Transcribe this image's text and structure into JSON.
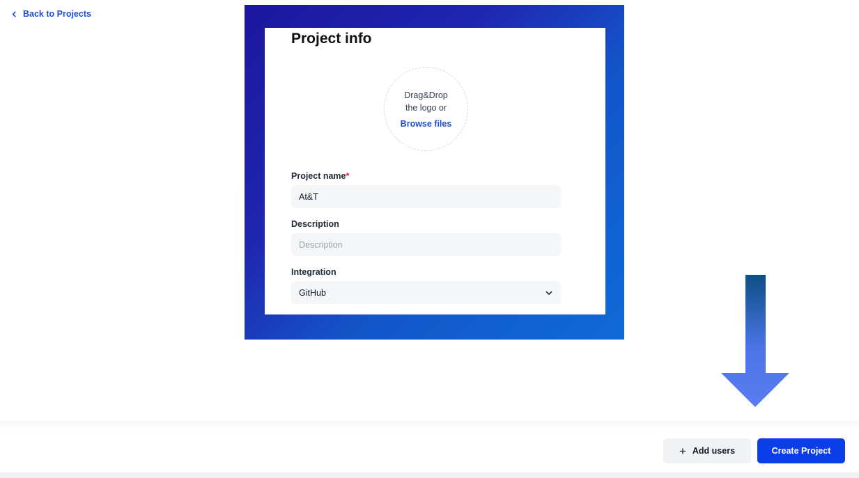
{
  "nav": {
    "back_label": "Back to Projects"
  },
  "form": {
    "title": "Project info",
    "dropzone": {
      "line1": "Drag&Drop",
      "line2": "the logo or",
      "browse_label": "Browse files"
    },
    "project_name": {
      "label": "Project name",
      "required_marker": "*",
      "value": "At&T"
    },
    "description": {
      "label": "Description",
      "placeholder": "Description",
      "value": ""
    },
    "integration": {
      "label": "Integration",
      "selected": "GitHub"
    }
  },
  "footer": {
    "add_users_label": "Add users",
    "create_label": "Create Project"
  },
  "colors": {
    "accent": "#0c3ee8",
    "link": "#1d4ed8",
    "frame_gradient_start": "#1c159e",
    "frame_gradient_end": "#0f6ad6",
    "arrow_top": "#0e4f86",
    "arrow_bottom": "#5b7cf2"
  },
  "icons": {
    "back": "chevron-left-icon",
    "select": "chevron-down-icon",
    "add": "plus-icon",
    "pointer": "arrow-down-icon"
  }
}
